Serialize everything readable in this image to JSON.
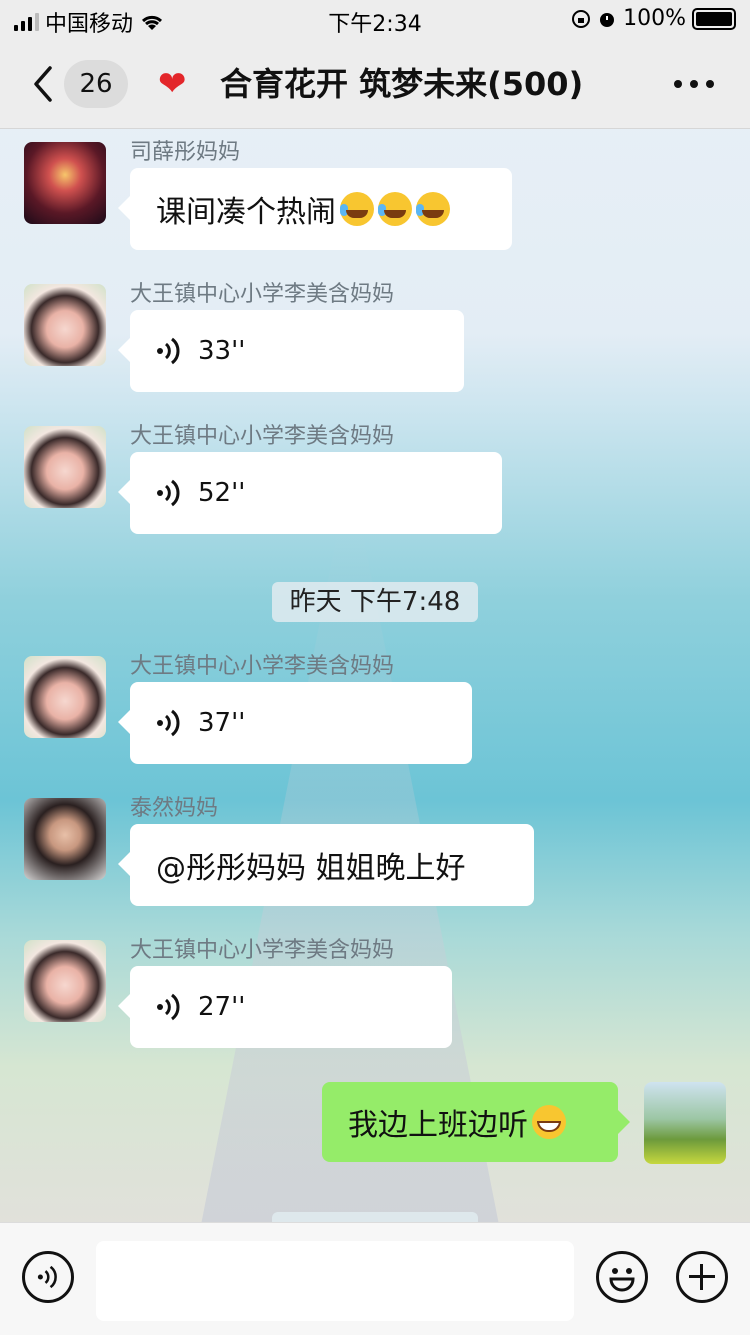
{
  "status_bar": {
    "carrier": "中国移动",
    "time": "下午2:34",
    "battery": "100%"
  },
  "nav": {
    "unread_count": "26",
    "title": "合育花开 筑梦未来(500)"
  },
  "messages": [
    {
      "sender": "司薛彤妈妈",
      "text": "课间凑个热闹"
    },
    {
      "sender": "大王镇中心小学李美含妈妈",
      "duration": "33''"
    },
    {
      "sender": "大王镇中心小学李美含妈妈",
      "duration": "52''"
    },
    {
      "sender": "大王镇中心小学李美含妈妈",
      "duration": "37''"
    },
    {
      "sender": "泰然妈妈",
      "text": "@彤彤妈妈 姐姐晚上好"
    },
    {
      "sender": "大王镇中心小学李美含妈妈",
      "duration": "27''"
    }
  ],
  "time_divider": "昨天 下午7:48",
  "my_message": "我边上班边听",
  "colors": {
    "nav_bg": "#ededed",
    "my_bubble": "#95ec69",
    "heart": "#e3262a"
  }
}
